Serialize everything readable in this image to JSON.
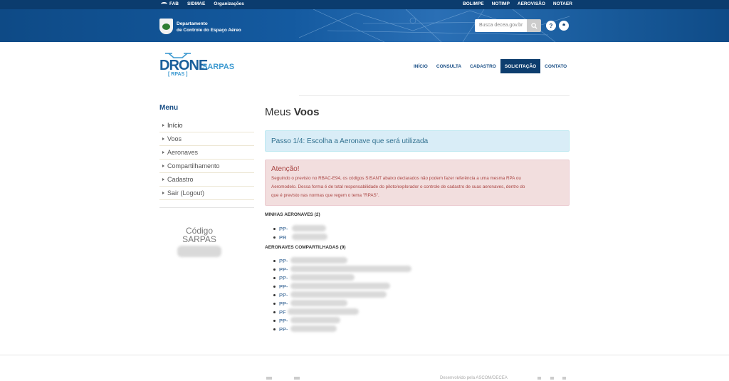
{
  "topbar": {
    "left_links": [
      "FAB",
      "SIDMAE",
      "Organizações"
    ],
    "right_links": [
      "BOLIMPE",
      "NOTIMP",
      "AEROVISÃO",
      "NOTAER"
    ]
  },
  "banner": {
    "org_line1": "Departamento",
    "org_line2": "de Controle do Espaço Aéreo",
    "search_placeholder": "Busca decea.gov.br",
    "help_label": "?",
    "chat_label": "❝"
  },
  "logo": {
    "drone": "DRONE",
    "rpas": "[ RPAS ]",
    "sarpas": "SARPAS"
  },
  "nav": {
    "items": [
      "INÍCIO",
      "CONSULTA",
      "CADASTRO",
      "SOLICITAÇÃO",
      "CONTATO"
    ],
    "active": "SOLICITAÇÃO"
  },
  "sidebar": {
    "title": "Menu",
    "items": [
      "Início",
      "Voos",
      "Aeronaves",
      "Compartilhamento",
      "Cadastro",
      "Sair (Logout)"
    ],
    "codigo_line1": "Código",
    "codigo_line2": "SARPAS"
  },
  "main": {
    "title_prefix": "Meus ",
    "title_bold": "Voos",
    "step": "Passo 1/4: Escolha a Aeronave que será utilizada",
    "alert_title": "Atenção!",
    "alert_line1": "Seguindo o previsto no RBAC-E94, os códigos SISANT abaixo declarados não podem fazer referência a uma mesma RPA ou",
    "alert_line2": "Aeromodelo. Dessa forma é de total responsabilidade do piloto/explorador o controle de cadastro de suas aeronaves, dentro do",
    "alert_line3": "que é previsto nas normas que regem o tema \"RPAS\".",
    "my_aircraft_title": "MINHAS AERONAVES (2)",
    "my_aircraft": [
      "PP-",
      "PR"
    ],
    "shared_title": "AERONAVES COMPARTILHADAS (9)",
    "shared": [
      "PP-",
      "PP-",
      "PP-",
      "PP-",
      "PP-",
      "PP-",
      "PF",
      "PP-",
      "PP-"
    ]
  },
  "footer": {
    "credit": "Desenvolvido pela ASCOM/DECEA"
  },
  "colors": {
    "topbar": "#0b3c6e",
    "banner": "#145aa0",
    "nav_active": "#0d3d6e",
    "info_bg": "#d9edf7",
    "alert_bg": "#f2dede",
    "alert_text": "#a94442"
  }
}
